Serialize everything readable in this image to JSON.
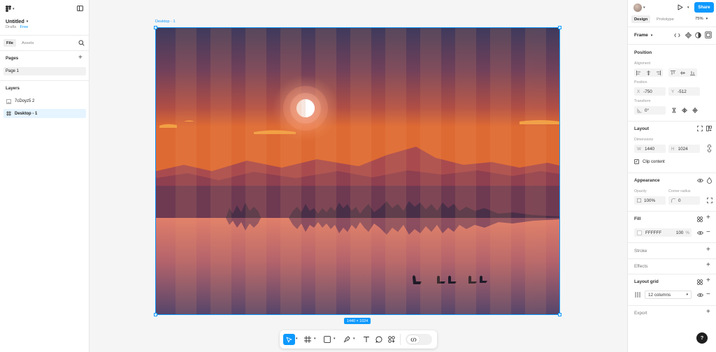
{
  "file": {
    "title": "Untitled",
    "location": "Drafts",
    "plan": "Free"
  },
  "left_tabs": [
    {
      "label": "File",
      "active": true
    },
    {
      "label": "Assets",
      "active": false
    }
  ],
  "pages": {
    "header": "Pages",
    "items": [
      {
        "label": "Page 1",
        "selected": true
      }
    ]
  },
  "layers": {
    "header": "Layers",
    "items": [
      {
        "label": "7cDoyz5 2",
        "icon": "image-icon",
        "selected": false
      },
      {
        "label": "Desktop - 1",
        "icon": "frame-icon",
        "selected": true
      }
    ]
  },
  "canvas": {
    "frame_label": "Desktop - 1",
    "size_badge": "1440 × 1024"
  },
  "toolbar": {
    "tools": [
      {
        "name": "move-tool",
        "active": true
      },
      {
        "name": "frame-tool",
        "active": false
      },
      {
        "name": "rectangle-tool",
        "active": false
      },
      {
        "name": "pen-tool",
        "active": false
      },
      {
        "name": "text-tool",
        "active": false
      },
      {
        "name": "comment-tool",
        "active": false
      },
      {
        "name": "actions-tool",
        "active": false
      },
      {
        "name": "dev-mode-toggle",
        "active": false
      }
    ]
  },
  "right": {
    "share_label": "Share",
    "tabs": [
      {
        "label": "Design",
        "active": true
      },
      {
        "label": "Prototype",
        "active": false
      }
    ],
    "zoom": "75%",
    "frame_selector": "Frame",
    "position": {
      "title": "Position",
      "alignment_label": "Alignment",
      "position_label": "Position",
      "x_label": "X",
      "x_value": "-750",
      "y_label": "Y",
      "y_value": "-512",
      "transform_label": "Transform",
      "rotation_value": "0°"
    },
    "layout": {
      "title": "Layout",
      "dimensions_label": "Dimensions",
      "w_label": "W",
      "w_value": "1440",
      "h_label": "H",
      "h_value": "1024",
      "clip_label": "Clip content",
      "clip_checked": true
    },
    "appearance": {
      "title": "Appearance",
      "opacity_label": "Opacity",
      "opacity_value": "100%",
      "radius_label": "Corner radius",
      "radius_value": "0"
    },
    "fill": {
      "title": "Fill",
      "hex": "FFFFFF",
      "opacity": "100",
      "percent": "%"
    },
    "stroke_title": "Stroke",
    "effects_title": "Effects",
    "layout_grid": {
      "title": "Layout grid",
      "value": "12 columns"
    },
    "export_title": "Export",
    "help": "?"
  },
  "colors": {
    "accent": "#0d99ff",
    "selection": "#e5f4ff"
  }
}
